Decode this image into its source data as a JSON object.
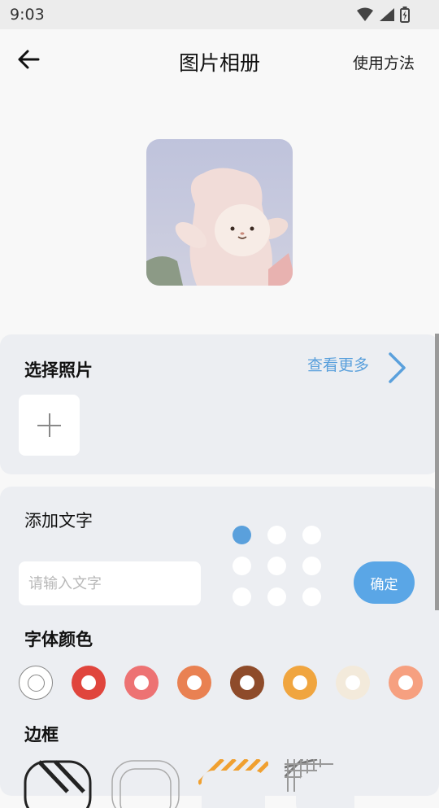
{
  "status_bar": {
    "time": "9:03",
    "icons": [
      "wifi-icon",
      "signal-icon",
      "battery-icon"
    ]
  },
  "nav": {
    "back_icon": "arrow-left-icon",
    "title": "图片相册",
    "help": "使用方法"
  },
  "preview": {
    "icon": "preview-photo-lamb-plush"
  },
  "photo_section": {
    "title": "选择照片",
    "more": "查看更多",
    "more_icon": "chevron-right-icon",
    "add_icon": "plus-icon"
  },
  "text_section": {
    "label": "添加文字",
    "placeholder": "请输入文字",
    "value": "",
    "confirm": "确定",
    "selected_position": 0,
    "position_count": 9
  },
  "color_section": {
    "title": "字体颜色",
    "swatches": [
      {
        "name": "none",
        "color": "#ffffff"
      },
      {
        "name": "red",
        "color": "#e0453d"
      },
      {
        "name": "pink",
        "color": "#ed7273"
      },
      {
        "name": "orange",
        "color": "#e98152"
      },
      {
        "name": "brown",
        "color": "#8e4b2a"
      },
      {
        "name": "amber",
        "color": "#f0a53f"
      },
      {
        "name": "cream",
        "color": "#f3eadb"
      },
      {
        "name": "peach",
        "color": "#f6a080"
      }
    ]
  },
  "frame_section": {
    "title": "边框",
    "frames": [
      "frame-black-stripe",
      "frame-outline",
      "frame-orange-stripe",
      "frame-plaid"
    ]
  },
  "colors": {
    "accent": "#5aa0dc",
    "panel": "#eceef2",
    "background": "#f8f8f8"
  }
}
